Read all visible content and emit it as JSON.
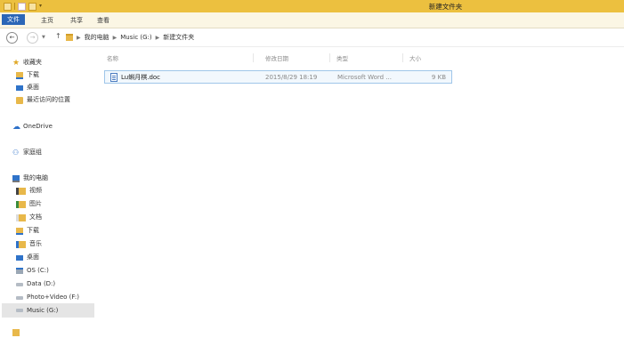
{
  "window": {
    "title": "新建文件夹"
  },
  "ribbon": {
    "tabs": [
      {
        "label": "文件"
      },
      {
        "label": "主页"
      },
      {
        "label": "共享"
      },
      {
        "label": "查看"
      }
    ]
  },
  "address": {
    "crumbs": [
      "我的电脑",
      "Music (G:)",
      "新建文件夹"
    ]
  },
  "columns": {
    "name": "名称",
    "modified": "修改日期",
    "type": "类型",
    "size": "大小"
  },
  "files": [
    {
      "name": "Lu蝌月棋.doc",
      "modified": "2015/8/29 18:19",
      "type": "Microsoft Word ...",
      "size": "9 KB"
    }
  ],
  "sidebar": {
    "favorites": {
      "label": "收藏夹",
      "items": [
        "下载",
        "桌面",
        "最近访问的位置"
      ]
    },
    "onedrive": {
      "label": "OneDrive"
    },
    "homegroup": {
      "label": "家庭组"
    },
    "computer": {
      "label": "我的电脑",
      "items": [
        "视频",
        "图片",
        "文档",
        "下载",
        "音乐",
        "桌面",
        "OS (C:)",
        "Data (D:)",
        "Photo+Video (F:)",
        "Music (G:)"
      ]
    }
  },
  "icons": {
    "accent": "#2b66b7",
    "titlebar": "#ecc03f"
  }
}
